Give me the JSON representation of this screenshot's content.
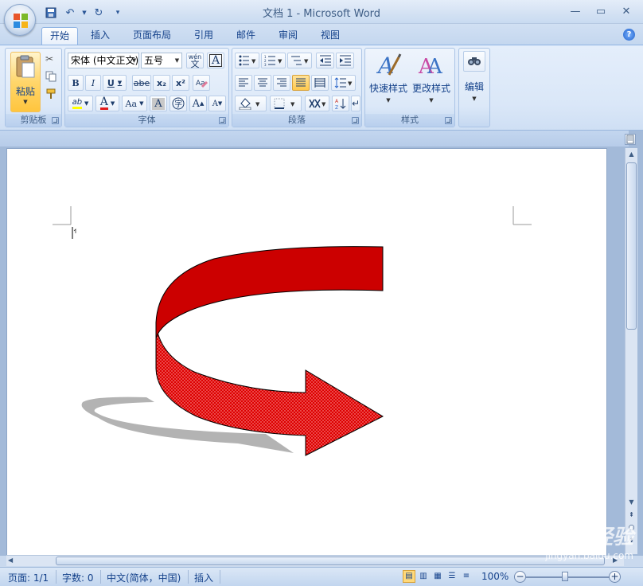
{
  "window": {
    "title": "文档 1 - Microsoft Word"
  },
  "tabs": [
    {
      "label": "开始",
      "active": true
    },
    {
      "label": "插入"
    },
    {
      "label": "页面布局"
    },
    {
      "label": "引用"
    },
    {
      "label": "邮件"
    },
    {
      "label": "审阅"
    },
    {
      "label": "视图"
    }
  ],
  "ribbon": {
    "clipboard": {
      "label": "剪贴板",
      "paste": "粘贴"
    },
    "font": {
      "label": "字体",
      "font_name": "宋体 (中文正文)",
      "font_size": "五号",
      "bold": "B",
      "italic": "I",
      "underline": "U",
      "strike": "abe",
      "subscript": "x₂",
      "superscript": "x²",
      "case": "Aa",
      "grow": "A",
      "shrink": "A",
      "phonetic": "wén",
      "font_color": "A",
      "char_shade": "A",
      "highlight": "ab"
    },
    "paragraph": {
      "label": "段落"
    },
    "styles": {
      "label": "样式",
      "quick_styles": "快速样式",
      "change_styles": "更改样式"
    },
    "editing": {
      "label": "编辑",
      "edit": "编辑"
    }
  },
  "statusbar": {
    "page": "页面: 1/1",
    "words": "字数: 0",
    "language": "中文(简体，中国)",
    "mode": "插入",
    "zoom": "100%"
  },
  "watermark": {
    "brand": "Baidu经验",
    "url": "jingyan.baidu.com"
  },
  "colors": {
    "arrow_fill": "#cc0000",
    "arrow_shadow": "#b3b3b3",
    "ribbon_text": "#15428b"
  }
}
